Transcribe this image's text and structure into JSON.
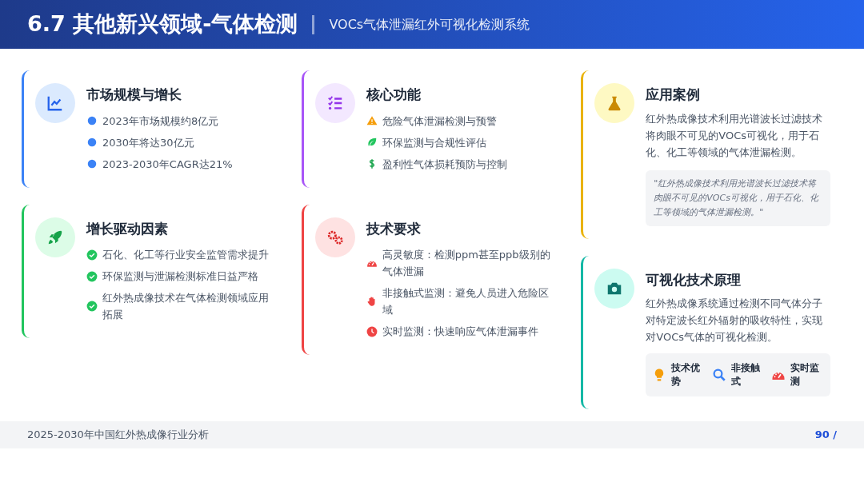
{
  "header": {
    "title": "6.7 其他新兴领域-气体检测",
    "subtitle": "VOCs气体泄漏红外可视化检测系统"
  },
  "columns": [
    {
      "cards": [
        {
          "title": "市场规模与增长",
          "color": "#3b82f6",
          "kind": "chart",
          "items": [
            {
              "kind": "dot",
              "text": "2023年市场规模约8亿元"
            },
            {
              "kind": "dot",
              "text": "2030年将达30亿元"
            },
            {
              "kind": "dot",
              "text": "2023-2030年CAGR达21%"
            }
          ]
        },
        {
          "title": "增长驱动因素",
          "color": "#22c55e",
          "kind": "rocket",
          "items": [
            {
              "kind": "check",
              "text": "石化、化工等行业安全监管需求提升"
            },
            {
              "kind": "check",
              "text": "环保监测与泄漏检测标准日益严格"
            },
            {
              "kind": "check",
              "text": "红外热成像技术在气体检测领域应用拓展"
            }
          ]
        }
      ]
    },
    {
      "cards": [
        {
          "title": "核心功能",
          "color": "#a855f7",
          "kind": "tasks",
          "items": [
            {
              "kind": "warning",
              "text": "危险气体泄漏检测与预警"
            },
            {
              "kind": "leaf",
              "text": "环保监测与合规性评估"
            },
            {
              "kind": "dollar",
              "text": "盈利性气体损耗预防与控制"
            }
          ]
        },
        {
          "title": "技术要求",
          "color": "#ef4444",
          "kind": "gears",
          "items": [
            {
              "kind": "gauge",
              "text": "高灵敏度：检测ppm甚至ppb级别的气体泄漏"
            },
            {
              "kind": "hand",
              "text": "非接触式监测：避免人员进入危险区域"
            },
            {
              "kind": "clock",
              "text": "实时监测：快速响应气体泄漏事件"
            }
          ]
        }
      ]
    },
    {
      "cards": [
        {
          "title": "应用案例",
          "color": "#eab308",
          "kind": "flask",
          "paragraph": "红外热成像技术利用光谱波长过滤技术将肉眼不可见的VOCs可视化，用于石化、化工等领域的气体泄漏检测。",
          "quote": "\"红外热成像技术利用光谱波长过滤技术将肉眼不可见的VOCs可视化，用于石化、化工等领域的气体泄漏检测。\""
        },
        {
          "title": "可视化技术原理",
          "color": "#14b8a6",
          "kind": "camera",
          "paragraph": "红外热成像系统通过检测不同气体分子对特定波长红外辐射的吸收特性，实现对VOCs气体的可视化检测。",
          "features": [
            {
              "kind": "bulb",
              "text": "技术优势"
            },
            {
              "kind": "search",
              "text": "非接触式"
            },
            {
              "kind": "gauge",
              "text": "实时监测"
            }
          ]
        }
      ]
    }
  ],
  "footer": {
    "left": "2025-2030年中国红外热成像行业分析",
    "page": "90 /"
  }
}
